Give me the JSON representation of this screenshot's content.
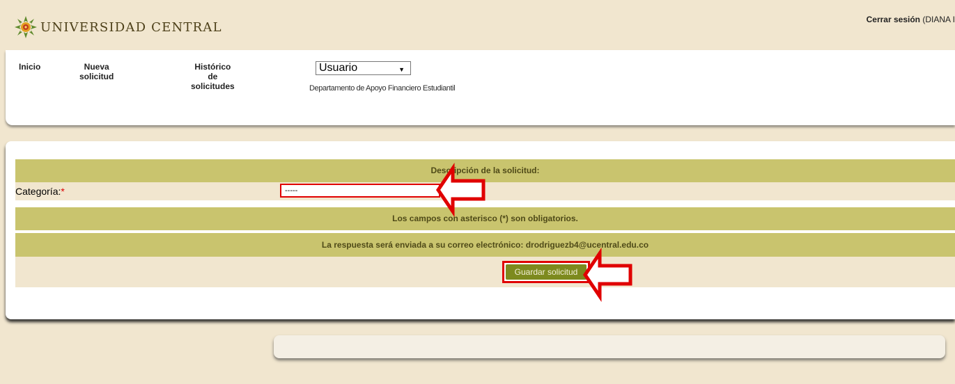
{
  "header": {
    "logo_text": "UNIVERSIDAD CENTRAL",
    "logout_label": "Cerrar sesión",
    "user_display": " (DIANA I"
  },
  "nav": {
    "inicio": "Inicio",
    "nueva_1": "Nueva",
    "nueva_2": "solicitud",
    "historico_1": "Histórico",
    "historico_2": "de",
    "historico_3": "solicitudes",
    "user_select_value": "Usuario",
    "department": "Departamento de Apoyo Financiero Estudiantil"
  },
  "form": {
    "section_title": "Descripción de la solicitud:",
    "category_label": "Categoría:",
    "required_marker": "*",
    "category_value": "-----",
    "required_note": "Los campos con asterisco (*) son obligatorios.",
    "email_note": "La respuesta será enviada a su correo electrónico: drodriguezb4@ucentral.edu.co",
    "save_label": "Guardar solicitud"
  },
  "colors": {
    "olive_row": "#c9c46e",
    "beige": "#f1e6cf",
    "button": "#7d8a1e",
    "highlight_red": "#e00000"
  },
  "icons": [
    "university-logo-icon",
    "dropdown-arrow-icon",
    "red-arrow-annotation-icon"
  ]
}
